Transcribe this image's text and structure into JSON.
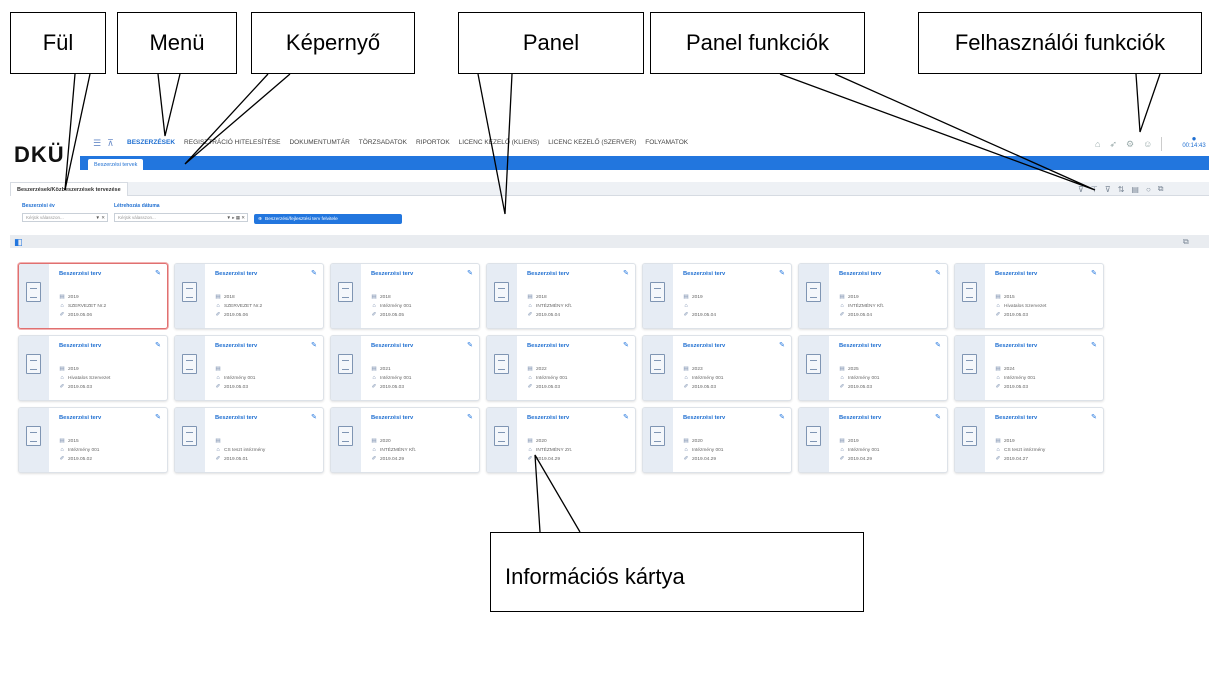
{
  "annotations": {
    "tab": "Fül",
    "menu": "Menü",
    "screen": "Képernyő",
    "panel": "Panel",
    "panel_functions": "Panel funkciók",
    "user_functions": "Felhasználói funkciók",
    "info_card": "Információs kártya"
  },
  "header": {
    "logo": "DKÜ",
    "menu_items": [
      "BESZERZÉSEK",
      "REGISZTRÁCIÓ HITELESÍTÉSE",
      "DOKUMENTUMTÁR",
      "TÖRZSADATOK",
      "RIPORTOK",
      "LICENC KEZELŐ (KLIENS)",
      "LICENC KEZELŐ (SZERVER)",
      "FOLYAMATOK"
    ],
    "screen_tab": "Beszerzési tervek",
    "clock": "00:14:43"
  },
  "tab": {
    "label": "Beszerzések/Közbeszerzések tervezése"
  },
  "filters": {
    "year_label": "Beszerzési év",
    "year_placeholder": "Kérjük válasszon...",
    "date_label": "Létrehozás dátuma",
    "date_placeholder": "Kérjük válasszon...",
    "add_button": "Beszerzési/fejlesztési terv felvitele"
  },
  "icons": {
    "tab_icons": [
      "menu-icon",
      "tree-icon"
    ],
    "user_tools": [
      "home-icon",
      "send-icon",
      "settings-icon",
      "user-icon"
    ],
    "panel_tools": [
      "filter-clear-icon",
      "filter-icon",
      "filter-settings-icon",
      "sort-icon",
      "list-view-icon",
      "refresh-icon",
      "export-icon"
    ]
  },
  "colors": {
    "accent": "#2276de",
    "selected_border": "#e07070"
  },
  "cards": [
    {
      "title": "Beszerzési terv",
      "year": "2019",
      "org": "SZERVEZET Nr.2",
      "date": "2019.05.06",
      "selected": true
    },
    {
      "title": "Beszerzési terv",
      "year": "2018",
      "org": "SZERVEZET Nr.2",
      "date": "2019.05.06"
    },
    {
      "title": "Beszerzési terv",
      "year": "2018",
      "org": "Intézmény 001",
      "date": "2019.05.05"
    },
    {
      "title": "Beszerzési terv",
      "year": "2018",
      "org": "INTÉZMÉNY Kft.",
      "date": "2019.05.04"
    },
    {
      "title": "Beszerzési terv",
      "year": "2019",
      "org": "",
      "date": "2019.05.04"
    },
    {
      "title": "Beszerzési terv",
      "year": "2019",
      "org": "INTÉZMÉNY Kft.",
      "date": "2019.05.04"
    },
    {
      "title": "Beszerzési terv",
      "year": "2015",
      "org": "Hivatalos Szervezet",
      "date": "2019.05.03"
    },
    {
      "title": "Beszerzési terv",
      "year": "2019",
      "org": "Hivatalos Szervezet",
      "date": "2019.05.03"
    },
    {
      "title": "Beszerzési terv",
      "year": "",
      "org": "Intézmény 001",
      "date": "2019.05.03"
    },
    {
      "title": "Beszerzési terv",
      "year": "2021",
      "org": "Intézmény 001",
      "date": "2019.05.03"
    },
    {
      "title": "Beszerzési terv",
      "year": "2022",
      "org": "Intézmény 001",
      "date": "2019.05.03"
    },
    {
      "title": "Beszerzési terv",
      "year": "2023",
      "org": "Intézmény 001",
      "date": "2019.05.03"
    },
    {
      "title": "Beszerzési terv",
      "year": "2025",
      "org": "Intézmény 001",
      "date": "2019.05.03"
    },
    {
      "title": "Beszerzési terv",
      "year": "2024",
      "org": "Intézmény 001",
      "date": "2019.05.03"
    },
    {
      "title": "Beszerzési terv",
      "year": "2015",
      "org": "Intézmény 001",
      "date": "2019.05.02"
    },
    {
      "title": "Beszerzési terv",
      "year": "",
      "org": "CS teszt intézmény",
      "date": "2019.05.01"
    },
    {
      "title": "Beszerzési terv",
      "year": "2020",
      "org": "INTÉZMÉNY Kft.",
      "date": "2019.04.29"
    },
    {
      "title": "Beszerzési terv",
      "year": "2020",
      "org": "INTÉZMÉNY Zrt.",
      "date": "2019.04.29"
    },
    {
      "title": "Beszerzési terv",
      "year": "2020",
      "org": "Intézmény 001",
      "date": "2019.04.29"
    },
    {
      "title": "Beszerzési terv",
      "year": "2019",
      "org": "Intézmény 001",
      "date": "2019.04.29"
    },
    {
      "title": "Beszerzési terv",
      "year": "2019",
      "org": "CS teszt intézmény",
      "date": "2019.04.27"
    }
  ]
}
